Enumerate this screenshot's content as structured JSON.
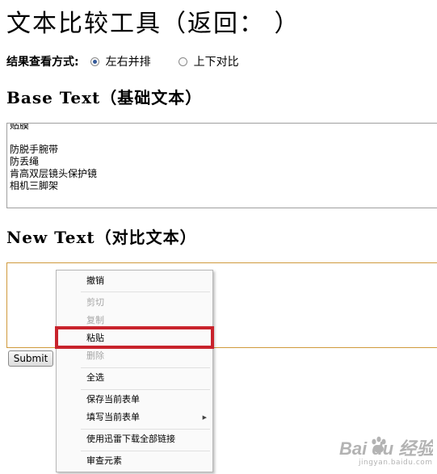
{
  "page": {
    "title": "文本比较工具（返回：                 ）"
  },
  "view_mode": {
    "label": "结果查看方式:",
    "options": [
      {
        "label": "左右并排",
        "selected": true
      },
      {
        "label": "上下对比",
        "selected": false
      }
    ]
  },
  "base": {
    "heading": "Base Text（基础文本）",
    "lines": [
      "贴膜",
      "",
      "防脱手腕带",
      "防丢绳",
      "肯高双层镜头保护镜",
      "相机三脚架"
    ]
  },
  "new": {
    "heading": "New Text（对比文本）",
    "value": ""
  },
  "submit_label": "Submit",
  "context_menu": {
    "items": [
      {
        "label": "撤销",
        "enabled": true
      },
      {
        "label": "剪切",
        "enabled": false
      },
      {
        "label": "复制",
        "enabled": false
      },
      {
        "label": "粘贴",
        "enabled": true,
        "highlighted": true
      },
      {
        "label": "删除",
        "enabled": false
      },
      {
        "label": "全选",
        "enabled": true
      },
      {
        "label": "保存当前表单",
        "enabled": true
      },
      {
        "label": "填写当前表单",
        "enabled": true,
        "submenu": true
      },
      {
        "label": "使用迅雷下载全部链接",
        "enabled": true
      },
      {
        "label": "审查元素",
        "enabled": true
      }
    ]
  },
  "watermark": {
    "brand": "Bai du 经验",
    "url": "jingyan.baidu.com"
  },
  "colors": {
    "highlight": "#c8232c",
    "focus_border": "#d09a3c",
    "radio_dot": "#355a9a"
  }
}
